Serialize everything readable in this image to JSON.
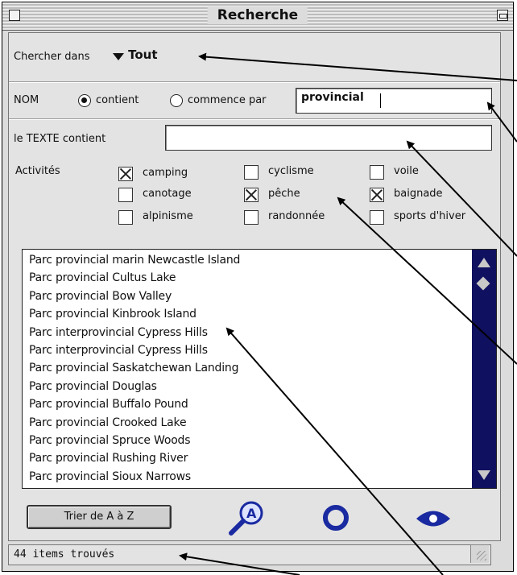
{
  "window": {
    "title": "Recherche"
  },
  "search_in": {
    "label": "Chercher dans",
    "value": "Tout"
  },
  "name_filter": {
    "label": "NOM",
    "options": [
      "contient",
      "commence par"
    ],
    "selected": "contient",
    "value": "provincial"
  },
  "text_filter": {
    "label": "le TEXTE contient",
    "value": ""
  },
  "activities": {
    "label": "Activités",
    "items": [
      {
        "label": "camping",
        "checked": true
      },
      {
        "label": "cyclisme",
        "checked": false
      },
      {
        "label": "voile",
        "checked": false
      },
      {
        "label": "canotage",
        "checked": false
      },
      {
        "label": "pêche",
        "checked": true
      },
      {
        "label": "baignade",
        "checked": true
      },
      {
        "label": "alpinisme",
        "checked": false
      },
      {
        "label": "randonnée",
        "checked": false
      },
      {
        "label": "sports d'hiver",
        "checked": false
      }
    ]
  },
  "results": [
    "Parc provincial marin Newcastle Island",
    "Parc provincial Cultus Lake",
    "Parc provincial Bow Valley",
    "Parc provincial Kinbrook Island",
    "Parc interprovincial Cypress Hills",
    "Parc interprovincial Cypress Hills",
    "Parc provincial Saskatchewan Landing",
    "Parc provincial Douglas",
    "Parc provincial Buffalo Pound",
    "Parc provincial Crooked Lake",
    "Parc provincial Spruce Woods",
    "Parc provincial Rushing River",
    "Parc provincial Sioux Narrows"
  ],
  "toolbar": {
    "sort_label": "Trier de A à Z"
  },
  "icons": {
    "search": "magnifier-icon",
    "reset": "circle-icon",
    "view": "eye-icon",
    "accent": "#1a2aa0"
  },
  "status": {
    "text": "44 items trouvés"
  }
}
